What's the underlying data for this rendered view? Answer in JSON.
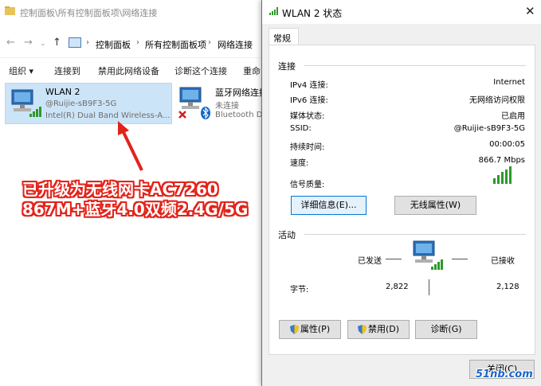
{
  "explorer": {
    "title": "控制面板\\所有控制面板项\\网络连接",
    "breadcrumb": [
      "控制面板",
      "所有控制面板项",
      "网络连接"
    ],
    "commands": [
      "组织 ▾",
      "连接到",
      "禁用此网络设备",
      "诊断这个连接",
      "重命"
    ],
    "adapters": [
      {
        "name": "WLAN 2",
        "network": "@Ruijie-sB9F3-5G",
        "device": "Intel(R) Dual Band Wireless-A..."
      },
      {
        "name": "蓝牙网络连接",
        "network": "未连接",
        "device": "Bluetooth D"
      }
    ]
  },
  "annotation": {
    "line1": "已升级为无线网卡AC7260",
    "line2": "867M+蓝牙4.0双频2.4G/5G",
    "color": "#e2231a"
  },
  "dialog": {
    "title": "WLAN 2 状态",
    "tab": "常规",
    "connection_group": "连接",
    "rows": [
      {
        "label": "IPv4 连接:",
        "value": "Internet"
      },
      {
        "label": "IPv6 连接:",
        "value": "无网络访问权限"
      },
      {
        "label": "媒体状态:",
        "value": "已启用"
      },
      {
        "label": "SSID:",
        "value": "@Ruijie-sB9F3-5G"
      },
      {
        "label": "持续时间:",
        "value": "00:00:05"
      },
      {
        "label": "速度:",
        "value": "866.7 Mbps"
      }
    ],
    "signal_label": "信号质量:",
    "signal_bars": 5,
    "details_button": "详细信息(E)...",
    "wireless_props_button": "无线属性(W)",
    "activity_group": "活动",
    "sent_label": "已发送",
    "received_label": "已接收",
    "bytes_label": "字节:",
    "bytes_sent": "2,822",
    "bytes_received": "2,128",
    "properties_button": "属性(P)",
    "disable_button": "禁用(D)",
    "diagnose_button": "诊断(G)",
    "close_button": "关闭(C)"
  },
  "watermark": "51nb.com"
}
